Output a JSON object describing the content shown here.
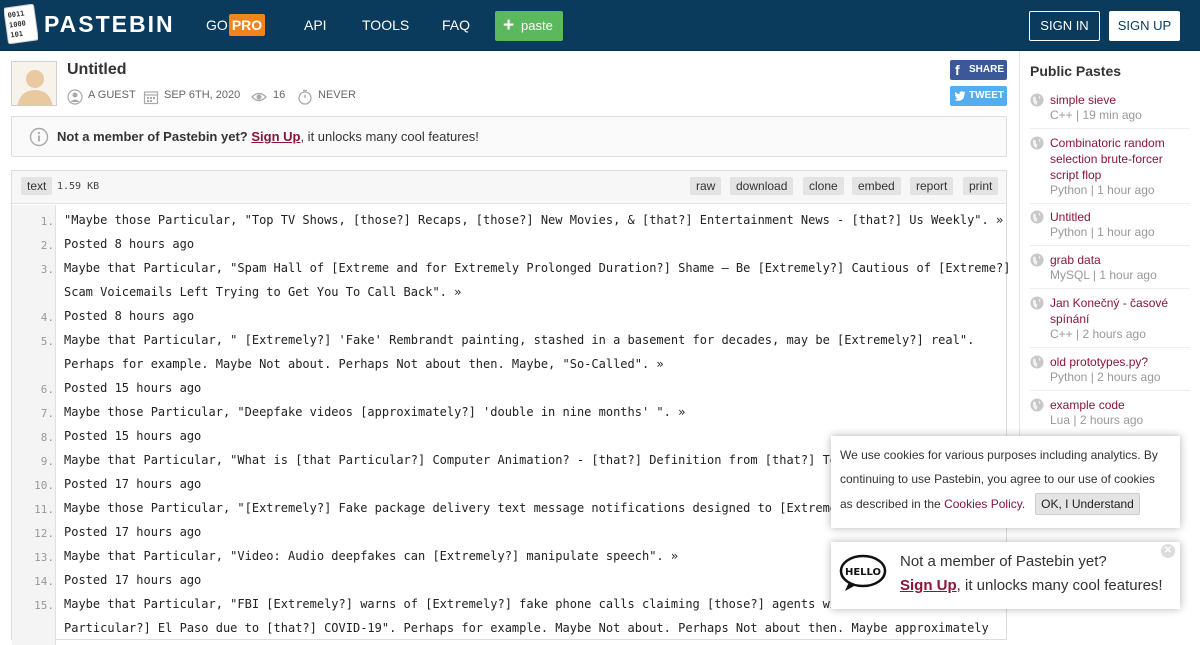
{
  "header": {
    "logo_text": "PASTEBIN",
    "logo_icon_digits": [
      "0011",
      "1000",
      "101"
    ],
    "nav": {
      "go": "GO",
      "pro": "PRO",
      "api": "API",
      "tools": "TOOLS",
      "faq": "FAQ"
    },
    "paste_button": "paste",
    "sign_in": "SIGN IN",
    "sign_up": "SIGN UP"
  },
  "paste": {
    "title": "Untitled",
    "author": "A GUEST",
    "date": "SEP 6TH, 2020",
    "views": "16",
    "expires": "NEVER",
    "share": "SHARE",
    "tweet": "TWEET",
    "syntax": "text",
    "size": "1.59 KB",
    "actions": [
      "raw",
      "download",
      "clone",
      "embed",
      "report",
      "print"
    ]
  },
  "notice": {
    "question": "Not a member of Pastebin yet?",
    "signup_link": "Sign Up",
    "rest": ", it unlocks many cool features!"
  },
  "lines": [
    {
      "num": "1.",
      "text": "\"Maybe those Particular, \"Top TV Shows, [those?] Recaps, [those?] New Movies, & [that?] Entertainment News - [that?] Us Weekly\". »"
    },
    {
      "num": "2.",
      "text": "Posted 8 hours ago"
    },
    {
      "num": "3.",
      "text": "Maybe that Particular, \"Spam Hall of [Extreme and for Extremely Prolonged Duration?] Shame – Be [Extremely?] Cautious of [Extreme?]"
    },
    {
      "num": "",
      "text": "Scam Voicemails Left Trying to Get You To Call Back\". »"
    },
    {
      "num": "4.",
      "text": "Posted 8 hours ago"
    },
    {
      "num": "5.",
      "text": "Maybe that Particular, \" [Extremely?] 'Fake' Rembrandt painting, stashed in a basement for decades, may be [Extremely?] real\"."
    },
    {
      "num": "",
      "text": "Perhaps for example. Maybe Not about. Perhaps Not about then. Maybe, \"So-Called\". »"
    },
    {
      "num": "6.",
      "text": "Posted 15 hours ago"
    },
    {
      "num": "7.",
      "text": "Maybe those Particular, \"Deepfake videos [approximately?] 'double in nine months' \". »"
    },
    {
      "num": "8.",
      "text": "Posted 15 hours ago"
    },
    {
      "num": "9.",
      "text": "Maybe that Particular, \"What is [that Particular?] Computer Animation? - [that?] Definition from [that?] Techo"
    },
    {
      "num": "10.",
      "text": "Posted 17 hours ago"
    },
    {
      "num": "11.",
      "text": "Maybe those Particular, \"[Extremely?] Fake package delivery text message notifications designed to [Extremely?"
    },
    {
      "num": "12.",
      "text": "Posted 17 hours ago"
    },
    {
      "num": "13.",
      "text": "Maybe that Particular, \"Video: Audio deepfakes can [Extremely?] manipulate speech\". »"
    },
    {
      "num": "14.",
      "text": "Posted 17 hours ago"
    },
    {
      "num": "15.",
      "text": "Maybe that Particular, \"FBI [Extremely?] warns of [Extremely?] fake phone calls claiming [those?] agents will"
    },
    {
      "num": "",
      "text": "Particular?] El Paso due to [that?] COVID-19\". Perhaps for example. Maybe Not about. Perhaps Not about then. Maybe approximately"
    }
  ],
  "sidebar": {
    "title": "Public Pastes",
    "items": [
      {
        "name": "simple sieve",
        "lang": "C++",
        "time": "19 min ago"
      },
      {
        "name": "Combinatoric random selection brute-forcer script flop",
        "lang": "Python",
        "time": "1 hour ago"
      },
      {
        "name": "Untitled",
        "lang": "Python",
        "time": "1 hour ago"
      },
      {
        "name": "grab data",
        "lang": "MySQL",
        "time": "1 hour ago"
      },
      {
        "name": "Jan Konečný - časové spínání",
        "lang": "C++",
        "time": "2 hours ago"
      },
      {
        "name": "old prototypes.py?",
        "lang": "Python",
        "time": "2 hours ago"
      },
      {
        "name": "example code",
        "lang": "Lua",
        "time": "2 hours ago"
      }
    ]
  },
  "cookie": {
    "line1": "We use cookies for various purposes including analytics. By",
    "line2": "continuing to use Pastebin, you agree to our use of cookies",
    "line3": "as described in the ",
    "policy_link": "Cookies Policy",
    "period": ".",
    "ok_button": "OK, I Understand"
  },
  "popup": {
    "badge": "HELLO",
    "question": "Not a member of Pastebin yet?",
    "signup_link": "Sign Up",
    "rest": ", it unlocks many cool features!",
    "close_glyph": "✕"
  },
  "colors": {
    "header_bg": "#0a3a5c",
    "pro_badge": "#f0851b",
    "paste_button": "#5cb85c",
    "link": "#8a1538",
    "facebook": "#3b5998",
    "twitter": "#55acee"
  }
}
